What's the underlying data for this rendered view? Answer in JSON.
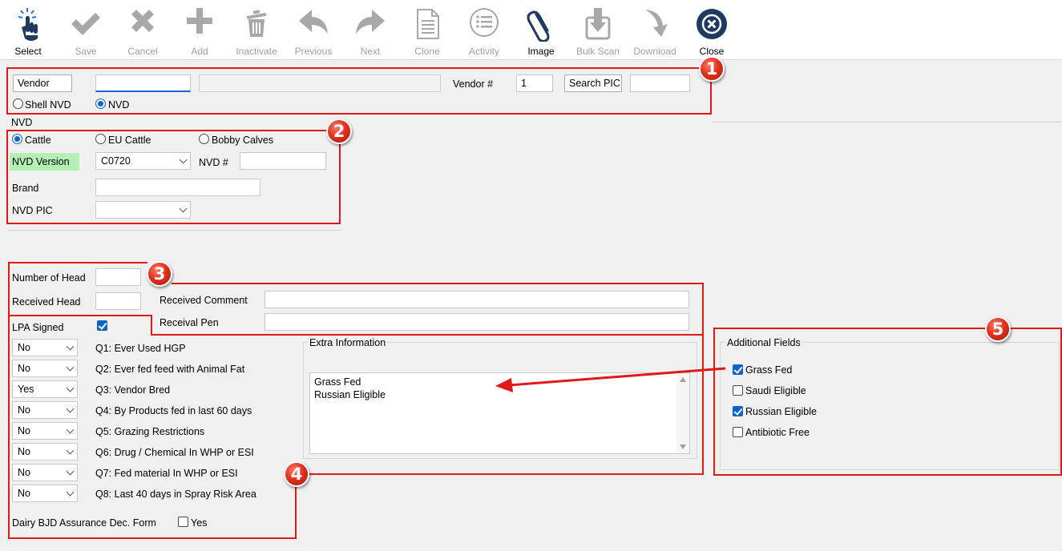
{
  "toolbar": {
    "buttons": [
      {
        "label": "Select",
        "icon": "pointer-hand-icon",
        "enabled": true
      },
      {
        "label": "Save",
        "icon": "checkmark-icon",
        "enabled": false
      },
      {
        "label": "Cancel",
        "icon": "x-icon",
        "enabled": false
      },
      {
        "label": "Add",
        "icon": "plus-icon",
        "enabled": false
      },
      {
        "label": "Inactivate",
        "icon": "trash-icon",
        "enabled": false
      },
      {
        "label": "Previous",
        "icon": "arrow-left-icon",
        "enabled": false
      },
      {
        "label": "Next",
        "icon": "arrow-right-icon",
        "enabled": false
      },
      {
        "label": "Clone",
        "icon": "document-icon",
        "enabled": false
      },
      {
        "label": "Activity",
        "icon": "list-icon",
        "enabled": false
      },
      {
        "label": "Image",
        "icon": "paperclip-icon",
        "enabled": true
      },
      {
        "label": "Bulk Scan",
        "icon": "bulk-scan-icon",
        "enabled": false
      },
      {
        "label": "Download",
        "icon": "download-icon",
        "enabled": false
      },
      {
        "label": "Close",
        "icon": "close-circle-icon",
        "enabled": true
      }
    ]
  },
  "vendor": {
    "vendor_button": "Vendor",
    "vendor_code": "",
    "vendor_name": "",
    "vendor_num_label": "Vendor #",
    "vendor_num": "1",
    "search_pic_button": "Search PIC",
    "search_pic_value": "",
    "shell_nvd_label": "Shell NVD",
    "nvd_label": "NVD",
    "selected": "NVD"
  },
  "nvd": {
    "section_label": "NVD",
    "types": [
      "Cattle",
      "EU Cattle",
      "Bobby Calves"
    ],
    "selected_type": "Cattle",
    "version_label": "NVD Version",
    "version_value": "C0720",
    "nvd_num_label": "NVD #",
    "nvd_num": "",
    "brand_label": "Brand",
    "brand_value": "",
    "pic_label": "NVD PIC",
    "pic_value": ""
  },
  "head": {
    "number_label": "Number of Head",
    "number_value": "",
    "received_label": "Received Head",
    "received_value": "",
    "comment_label": "Received Comment",
    "comment_value": "",
    "pen_label": "Receival Pen",
    "pen_value": ""
  },
  "lpa": {
    "signed_label": "LPA Signed",
    "signed": true,
    "questions": [
      {
        "answer": "No",
        "text": "Q1: Ever Used HGP"
      },
      {
        "answer": "No",
        "text": "Q2: Ever fed feed with Animal Fat"
      },
      {
        "answer": "Yes",
        "text": "Q3: Vendor Bred"
      },
      {
        "answer": "No",
        "text": "Q4: By Products fed in last 60 days"
      },
      {
        "answer": "No",
        "text": "Q5: Grazing Restrictions"
      },
      {
        "answer": "No",
        "text": "Q6: Drug / Chemical In WHP or ESI"
      },
      {
        "answer": "No",
        "text": "Q7: Fed material In WHP or ESI"
      },
      {
        "answer": "No",
        "text": "Q8: Last 40 days in Spray Risk Area"
      }
    ],
    "dairy_label": "Dairy BJD Assurance Dec. Form",
    "dairy_yes_label": "Yes",
    "dairy_yes": false
  },
  "extra": {
    "title": "Extra Information",
    "lines": [
      "Grass Fed",
      "Russian Eligible"
    ]
  },
  "additional": {
    "title": "Additional Fields",
    "fields": [
      {
        "label": "Grass Fed",
        "checked": true
      },
      {
        "label": "Saudi Eligible",
        "checked": false
      },
      {
        "label": "Russian Eligible",
        "checked": true
      },
      {
        "label": "Antibiotic Free",
        "checked": false
      }
    ]
  },
  "badges": [
    "1",
    "2",
    "3",
    "4",
    "5"
  ],
  "colors": {
    "accent": "#0a64c8",
    "annotation": "#e01818",
    "highlight": "#b4f0b4",
    "close_icon": "#1e3a5f"
  }
}
